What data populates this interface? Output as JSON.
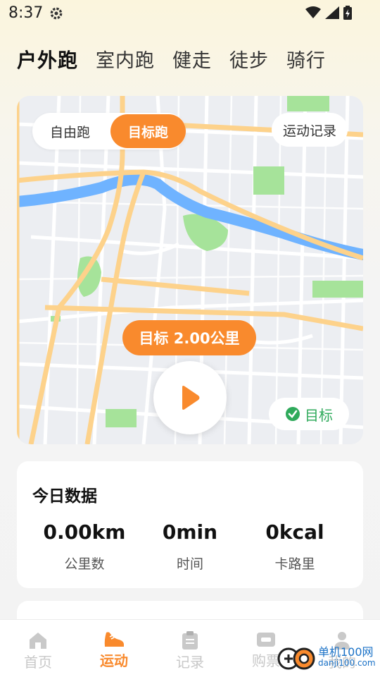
{
  "status_bar": {
    "time": "8:37"
  },
  "sport_tabs": [
    {
      "label": "户外跑",
      "active": true
    },
    {
      "label": "室内跑",
      "active": false
    },
    {
      "label": "健走",
      "active": false
    },
    {
      "label": "徒步",
      "active": false
    },
    {
      "label": "骑行",
      "active": false
    }
  ],
  "map_card": {
    "mode_options": [
      {
        "label": "自由跑",
        "active": false
      },
      {
        "label": "目标跑",
        "active": true
      }
    ],
    "record_label": "运动记录",
    "target_label": "目标 2.00公里",
    "goal_label": "目标"
  },
  "today": {
    "title": "今日数据",
    "stats": [
      {
        "value": "0.00km",
        "label": "公里数"
      },
      {
        "value": "0min",
        "label": "时间"
      },
      {
        "value": "0kcal",
        "label": "卡路里"
      }
    ]
  },
  "bottom_nav": [
    {
      "label": "首页",
      "icon": "home-icon",
      "active": false
    },
    {
      "label": "运动",
      "icon": "shoe-icon",
      "active": true
    },
    {
      "label": "记录",
      "icon": "clipboard-icon",
      "active": false
    },
    {
      "label": "购票",
      "icon": "ticket-icon",
      "active": false
    },
    {
      "label": "我的",
      "icon": "user-icon",
      "active": false
    }
  ],
  "watermark": {
    "text": "单机100网",
    "sub": "danji100.com"
  },
  "colors": {
    "accent": "#f98a2d",
    "goal_green": "#2faa5b",
    "river": "#6fb3ff",
    "park": "#a6e39a"
  }
}
